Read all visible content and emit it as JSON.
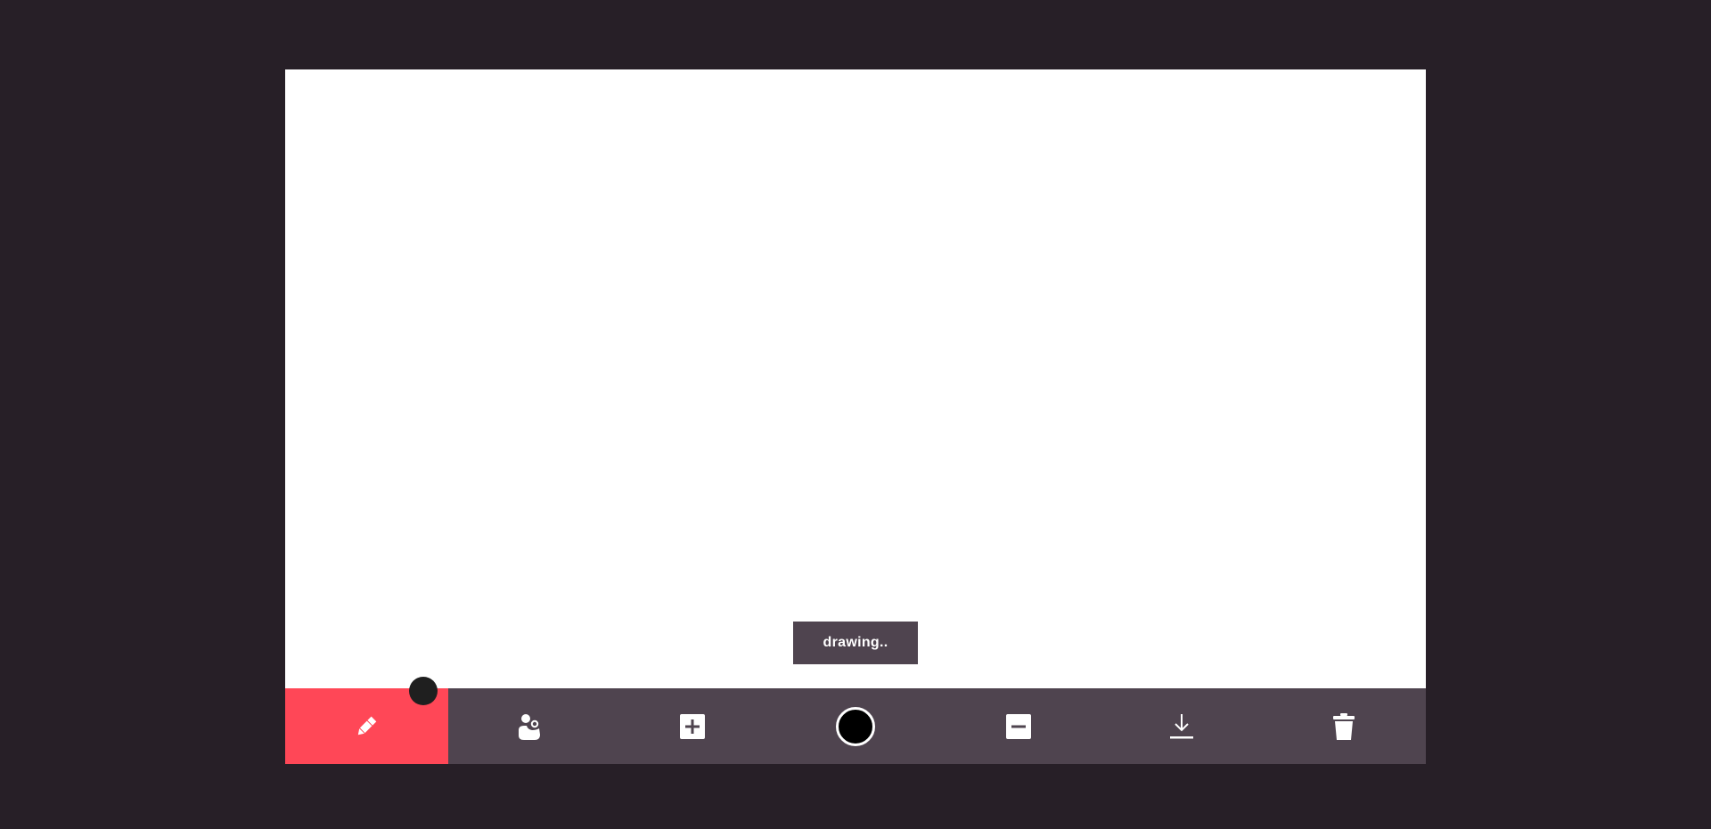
{
  "status": {
    "label": "drawing.."
  },
  "toolbar": {
    "tools": [
      {
        "name": "pen",
        "icon": "pencil-icon",
        "active": true
      },
      {
        "name": "eraser",
        "icon": "eraser-icon",
        "active": false
      },
      {
        "name": "increase-size",
        "icon": "plus-square-icon",
        "active": false
      },
      {
        "name": "color",
        "icon": "color-swatch",
        "active": false
      },
      {
        "name": "decrease-size",
        "icon": "minus-square-icon",
        "active": false
      },
      {
        "name": "download",
        "icon": "download-icon",
        "active": false
      },
      {
        "name": "clear",
        "icon": "trash-icon",
        "active": false
      }
    ],
    "current_color": "#000000"
  },
  "colors": {
    "background": "#271f27",
    "canvas": "#ffffff",
    "toolbar": "#4f444f",
    "accent": "#ff4757",
    "icon": "#ffffff",
    "brush_cursor": "#1f1f1f"
  }
}
